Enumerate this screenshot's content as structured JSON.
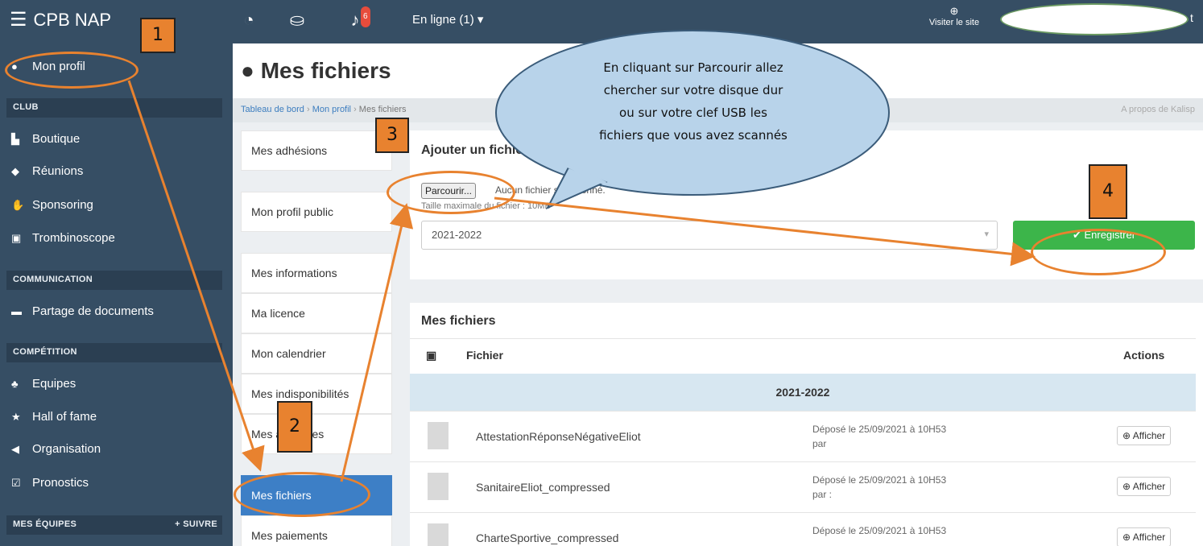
{
  "topbar": {
    "app_title": "CPB NAP",
    "notif_count": "6",
    "online_status": "En ligne (1) ▾",
    "visit_site": "Visiter le site",
    "user_tail": "t"
  },
  "sidebar": {
    "profile": "Mon profil",
    "sections": {
      "club": "CLUB",
      "communication": "COMMUNICATION",
      "competition": "COMPÉTITION",
      "teams": "MES ÉQUIPES",
      "follow": "+ SUIVRE"
    },
    "club_items": [
      "Boutique",
      "Réunions",
      "Sponsoring",
      "Trombinoscope"
    ],
    "communication_items": [
      "Partage de documents"
    ],
    "competition_items": [
      "Equipes",
      "Hall of fame",
      "Organisation",
      "Pronostics"
    ]
  },
  "page": {
    "title": "Mes fichiers",
    "breadcrumb": [
      "Tableau de bord",
      "Mon profil",
      "Mes fichiers"
    ],
    "about": "A propos de Kalisp"
  },
  "profile_nav": {
    "items": [
      "Mes adhésions",
      "Mon profil public",
      "Mes informations",
      "Ma licence",
      "Mon calendrier",
      "Mes indisponibilités",
      "Mes absences",
      "Mes fichiers",
      "Mes paiements"
    ],
    "active": "Mes fichiers"
  },
  "upload": {
    "title": "Ajouter un fichier",
    "browse_label": "Parcourir...",
    "no_file": "Aucun fichier sélectionné.",
    "max_size": "Taille maximale du fichier : 10MB",
    "season_value": "2021-2022",
    "save_label": "Enregistrer"
  },
  "files": {
    "title": "Mes fichiers",
    "col_file": "Fichier",
    "col_actions": "Actions",
    "group": "2021-2022",
    "rows": [
      {
        "name": "AttestationRéponseNégativeEliot",
        "uploaded": "Déposé le 25/09/2021 à 10H53",
        "by": "par",
        "action": "Afficher"
      },
      {
        "name": "SanitaireEliot_compressed",
        "uploaded": "Déposé le 25/09/2021 à 10H53",
        "by": "par :",
        "action": "Afficher"
      },
      {
        "name": "CharteSportive_compressed",
        "uploaded": "Déposé le 25/09/2021 à 10H53",
        "by": "",
        "action": "Afficher"
      }
    ]
  },
  "annotations": {
    "steps": [
      "1",
      "2",
      "3",
      "4"
    ],
    "bubble_lines": [
      "En cliquant sur Parcourir allez",
      "chercher sur votre disque dur",
      "ou sur votre clef USB les",
      "fichiers que vous avez scannés"
    ],
    "colors": {
      "orange": "#e8822f",
      "bubble": "#b8d3ea",
      "sidebar": "#364e64",
      "active": "#3d7fc6",
      "save": "#3cb54a"
    }
  }
}
